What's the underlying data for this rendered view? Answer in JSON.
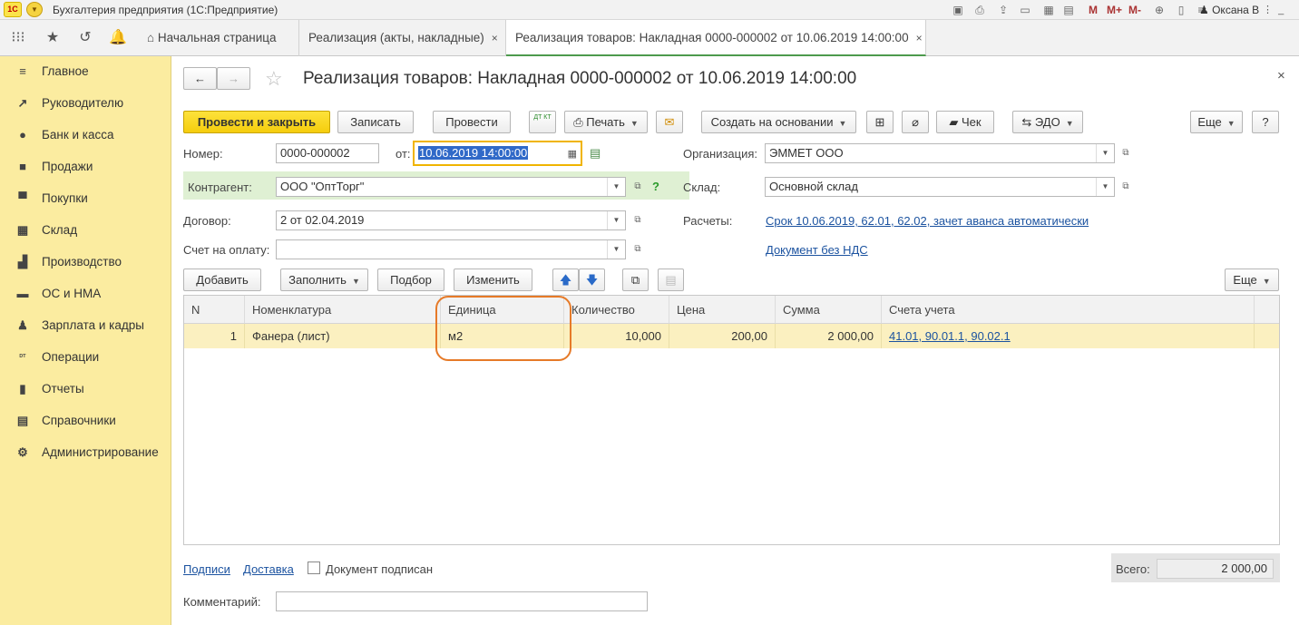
{
  "app": {
    "logo": "1С",
    "title": "Бухгалтерия предприятия  (1С:Предприятие)",
    "toolbar_m": [
      "M",
      "M+",
      "M-"
    ],
    "user": "Оксана В"
  },
  "tabs": [
    {
      "label": "Начальная страница",
      "closable": false
    },
    {
      "label": "Реализация (акты, накладные)",
      "closable": true
    },
    {
      "label": "Реализация товаров: Накладная 0000-000002 от 10.06.2019 14:00:00",
      "closable": true,
      "active": true
    }
  ],
  "tab_close": "×",
  "sidebar": {
    "items": [
      {
        "label": "Главное",
        "icon": "menu-icon",
        "glyph": "≡"
      },
      {
        "label": "Руководителю",
        "icon": "trend-icon",
        "glyph": "↗"
      },
      {
        "label": "Банк и касса",
        "icon": "coin-icon",
        "glyph": "●"
      },
      {
        "label": "Продажи",
        "icon": "bag-icon",
        "glyph": "■"
      },
      {
        "label": "Покупки",
        "icon": "cart-icon",
        "glyph": "▀"
      },
      {
        "label": "Склад",
        "icon": "warehouse-icon",
        "glyph": "▦"
      },
      {
        "label": "Производство",
        "icon": "factory-icon",
        "glyph": "▟"
      },
      {
        "label": "ОС и НМА",
        "icon": "truck-icon",
        "glyph": "▬"
      },
      {
        "label": "Зарплата и кадры",
        "icon": "person-icon",
        "glyph": "♟"
      },
      {
        "label": "Операции",
        "icon": "dtkt-icon",
        "glyph": "ᴰᵀ"
      },
      {
        "label": "Отчеты",
        "icon": "bar-chart-icon",
        "glyph": "▮"
      },
      {
        "label": "Справочники",
        "icon": "book-icon",
        "glyph": "▤"
      },
      {
        "label": "Администрирование",
        "icon": "gear-icon",
        "glyph": "⚙"
      }
    ]
  },
  "form": {
    "title": "Реализация товаров: Накладная 0000-000002 от 10.06.2019 14:00:00",
    "close": "×",
    "toolbar": {
      "post_and_close": "Провести и закрыть",
      "save": "Записать",
      "post": "Провести",
      "dtkt": "ДТ КТ",
      "print": "Печать",
      "create_based": "Создать на основании",
      "receipt": "Чек",
      "edo": "ЭДО",
      "more": "Еще",
      "help": "?"
    },
    "number_label": "Номер:",
    "number_value": "0000-000002",
    "date_label": "от:",
    "date_value": "10.06.2019 14:00:00",
    "org_label": "Организация:",
    "org_value": "ЭММЕТ ООО",
    "contractor_label": "Контрагент:",
    "contractor_value": "ООО \"ОптТорг\"",
    "contractor_help": "?",
    "warehouse_label": "Склад:",
    "warehouse_value": "Основной склад",
    "contract_label": "Договор:",
    "contract_value": "2 от 02.04.2019",
    "settlements_label": "Расчеты:",
    "settlements_link": "Срок 10.06.2019, 62.01, 62.02, зачет аванса автоматически",
    "invoice_label": "Счет на оплату:",
    "invoice_value": "",
    "vat_link": "Документ без НДС",
    "table_toolbar": {
      "add": "Добавить",
      "fill": "Заполнить",
      "pick": "Подбор",
      "change": "Изменить",
      "more": "Еще"
    },
    "table": {
      "columns": [
        "N",
        "Номенклатура",
        "Единица",
        "Количество",
        "Цена",
        "Сумма",
        "Счета учета"
      ],
      "rows": [
        {
          "n": "1",
          "item": "Фанера (лист)",
          "unit": "м2",
          "qty": "10,000",
          "price": "200,00",
          "sum": "2 000,00",
          "accounts": "41.01, 90.01.1, 90.02.1"
        }
      ]
    },
    "footer": {
      "signatures_link": "Подписи",
      "delivery_link": "Доставка",
      "signed_label": "Документ подписан",
      "signed_checked": false,
      "total_label": "Всего:",
      "total_value": "2 000,00",
      "comment_label": "Комментарий:",
      "comment_value": ""
    }
  },
  "colors": {
    "sidebar_bg": "#fbeca0",
    "primary_button": "#f5cd0d",
    "link": "#1c53a0",
    "highlight_ring": "#e67a28",
    "row_selected": "#fbf0c0"
  }
}
